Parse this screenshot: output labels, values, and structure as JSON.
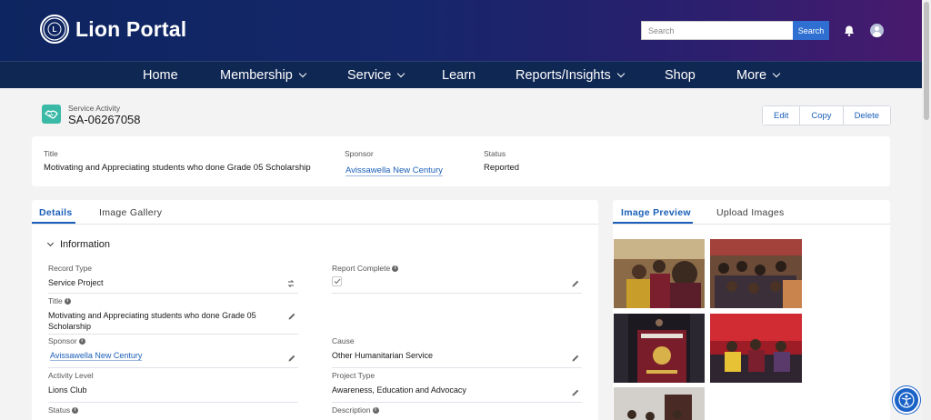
{
  "header": {
    "logo_mark": "LIONS",
    "brand": "Lion Portal",
    "search_placeholder": "Search",
    "search_button": "Search",
    "bell_icon": "bell-icon",
    "avatar_icon": "user-avatar-icon",
    "colors": {
      "primary": "#0f2753",
      "accent": "#2e6fd1",
      "gradient_end": "#4a1a6e"
    }
  },
  "nav": {
    "items": [
      {
        "label": "Home",
        "dropdown": false
      },
      {
        "label": "Membership",
        "dropdown": true
      },
      {
        "label": "Service",
        "dropdown": true
      },
      {
        "label": "Learn",
        "dropdown": false
      },
      {
        "label": "Reports/Insights",
        "dropdown": true
      },
      {
        "label": "Shop",
        "dropdown": false
      },
      {
        "label": "More",
        "dropdown": true
      }
    ]
  },
  "record": {
    "type": "Service Activity",
    "number": "SA-06267058",
    "icon": "handshake-icon",
    "actions": [
      "Edit",
      "Copy",
      "Delete"
    ]
  },
  "highlights": [
    {
      "label": "Title",
      "value": "Motivating and Appreciating students who done Grade 05 Scholarship",
      "link": false
    },
    {
      "label": "Sponsor",
      "value": "Avissawella New Century",
      "link": true
    },
    {
      "label": "Status",
      "value": "Reported",
      "link": false
    }
  ],
  "details": {
    "tabs": [
      "Details",
      "Image Gallery"
    ],
    "section": "Information",
    "fields": {
      "record_type": {
        "label": "Record Type",
        "value": "Service Project"
      },
      "report_complete": {
        "label": "Report Complete",
        "checked": true
      },
      "title": {
        "label": "Title",
        "value": "Motivating and Appreciating students who done Grade 05 Scholarship"
      },
      "sponsor": {
        "label": "Sponsor",
        "value": "Avissawella New Century"
      },
      "cause": {
        "label": "Cause",
        "value": "Other Humanitarian Service"
      },
      "activity_level": {
        "label": "Activity Level",
        "value": "Lions Club"
      },
      "project_type": {
        "label": "Project Type",
        "value": "Awareness, Education and Advocacy"
      },
      "status": {
        "label": "Status"
      },
      "description": {
        "label": "Description"
      }
    }
  },
  "images": {
    "tabs": [
      "Image Preview",
      "Upload Images"
    ],
    "thumbs": [
      {
        "name": "photo-group-selfie",
        "colors": [
          "#7a5a3c",
          "#3a2a20",
          "#e8d6a6",
          "#7b1e2e"
        ]
      },
      {
        "name": "photo-audience-seated",
        "colors": [
          "#5b3b2d",
          "#a3413b",
          "#2a2a2a",
          "#c9834d"
        ]
      },
      {
        "name": "photo-lions-banner",
        "colors": [
          "#1c1a20",
          "#7a1d2a",
          "#d9b14a",
          "#e6e2d8"
        ]
      },
      {
        "name": "photo-event-hall",
        "colors": [
          "#9e1c25",
          "#d12b34",
          "#2f2530",
          "#e6c234"
        ]
      },
      {
        "name": "photo-stage-ceremony",
        "colors": [
          "#d3d0cc",
          "#4a2a24",
          "#b3212d",
          "#ddd3c0"
        ]
      }
    ]
  },
  "accessibility_icon": "accessibility-icon"
}
